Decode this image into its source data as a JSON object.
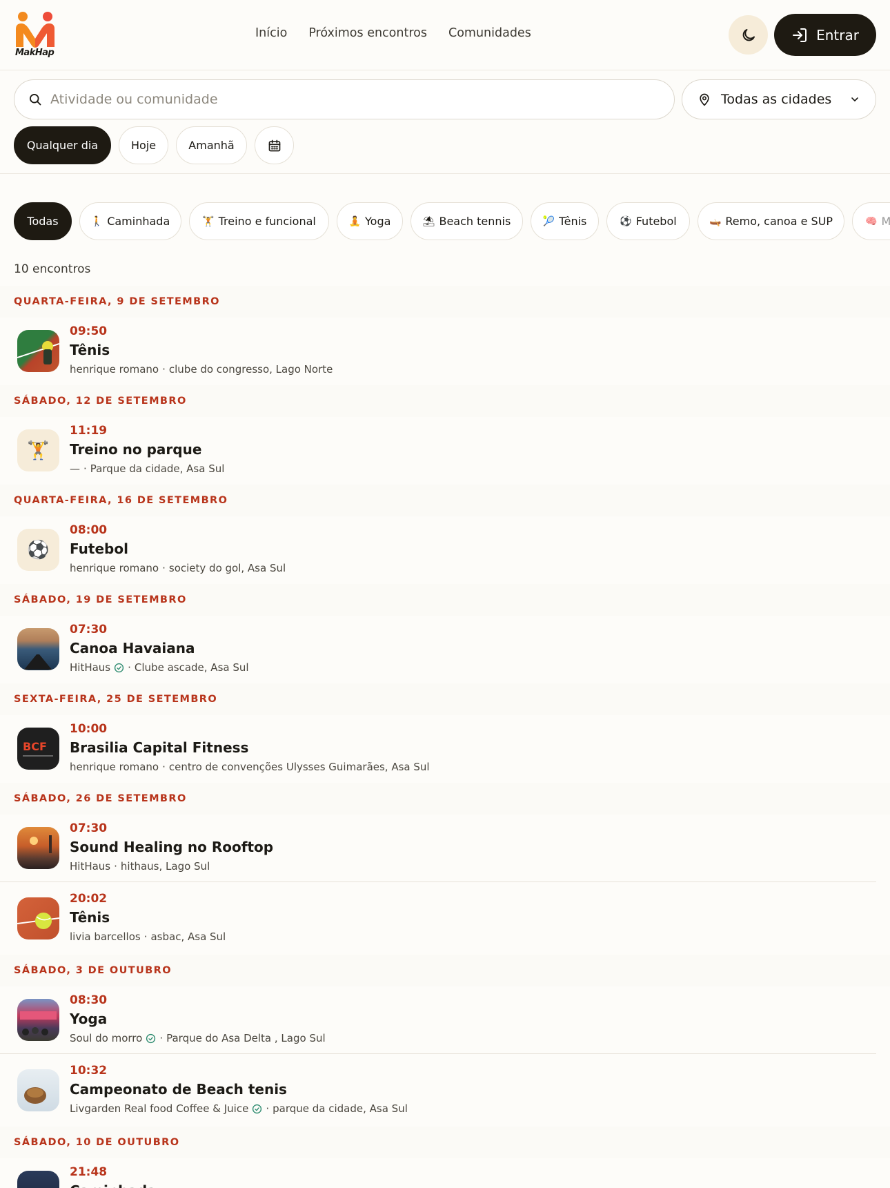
{
  "brand": {
    "name": "MakHap"
  },
  "nav": {
    "items": [
      "Início",
      "Próximos encontros",
      "Comunidades"
    ]
  },
  "header": {
    "login_label": "Entrar"
  },
  "search": {
    "placeholder": "Atividade ou comunidade",
    "value": ""
  },
  "city": {
    "selected": "Todas as cidades"
  },
  "day_filters": [
    "Qualquer dia",
    "Hoje",
    "Amanhã"
  ],
  "categories": [
    {
      "emoji": "🚶",
      "label": "Todas"
    },
    {
      "emoji": "🚶",
      "label": "Caminhada"
    },
    {
      "emoji": "🏋",
      "label": "Treino e funcional"
    },
    {
      "emoji": "🧘",
      "label": "Yoga"
    },
    {
      "emoji": "⛱",
      "label": "Beach tennis"
    },
    {
      "emoji": "🎾",
      "label": "Tênis"
    },
    {
      "emoji": "⚽",
      "label": "Futebol"
    },
    {
      "emoji": "🛶",
      "label": "Remo, canoa e SUP"
    },
    {
      "emoji": "🧠",
      "label": "M"
    }
  ],
  "results": {
    "count_label": "10 encontros"
  },
  "groups": [
    {
      "date": "QUARTA-FEIRA, 9 DE SETEMBRO",
      "events": [
        {
          "time": "09:50",
          "title": "Tênis",
          "organizer": "henrique romano",
          "verified": false,
          "location": "clube do congresso, Lago Norte",
          "thumb": "tennis-court"
        }
      ]
    },
    {
      "date": "SÁBADO, 12 DE SETEMBRO",
      "events": [
        {
          "time": "11:19",
          "title": "Treino no parque",
          "organizer": "—",
          "verified": false,
          "location": "Parque da cidade, Asa Sul",
          "thumb": "emoji",
          "emoji": "🏋"
        }
      ]
    },
    {
      "date": "QUARTA-FEIRA, 16 DE SETEMBRO",
      "events": [
        {
          "time": "08:00",
          "title": "Futebol",
          "organizer": "henrique romano",
          "verified": false,
          "location": "society do gol, Asa Sul",
          "thumb": "emoji",
          "emoji": "⚽"
        }
      ]
    },
    {
      "date": "SÁBADO, 19 DE SETEMBRO",
      "events": [
        {
          "time": "07:30",
          "title": "Canoa Havaiana",
          "organizer": "HitHaus",
          "verified": true,
          "location": "Clube ascade, Asa Sul",
          "thumb": "canoe"
        }
      ]
    },
    {
      "date": "SEXTA-FEIRA, 25 DE SETEMBRO",
      "events": [
        {
          "time": "10:00",
          "title": "Brasilia Capital Fitness",
          "organizer": "henrique romano",
          "verified": false,
          "location": "centro de convenções Ulysses Guimarães, Asa Sul",
          "thumb": "bcf"
        }
      ]
    },
    {
      "date": "SÁBADO, 26 DE SETEMBRO",
      "events": [
        {
          "time": "07:30",
          "title": "Sound Healing no Rooftop",
          "organizer": "HitHaus",
          "verified": false,
          "location": "hithaus, Lago Sul",
          "thumb": "sunset"
        },
        {
          "time": "20:02",
          "title": "Tênis",
          "organizer": "livia barcellos",
          "verified": false,
          "location": "asbac, Asa Sul",
          "thumb": "tennis-ball"
        }
      ]
    },
    {
      "date": "SÁBADO, 3 DE OUTUBRO",
      "events": [
        {
          "time": "08:30",
          "title": "Yoga",
          "organizer": "Soul do morro",
          "verified": true,
          "location": "Parque do Asa Delta , Lago Sul",
          "thumb": "group"
        },
        {
          "time": "10:32",
          "title": "Campeonato de Beach tenis",
          "organizer": "Livgarden Real food Coffee & Juice",
          "verified": true,
          "location": "parque da cidade, Asa Sul",
          "thumb": "bread"
        }
      ]
    },
    {
      "date": "SÁBADO, 10 DE OUTUBRO",
      "events": [
        {
          "time": "21:48",
          "title": "Caminhada",
          "organizer": "",
          "verified": false,
          "location": "",
          "thumb": "night"
        }
      ]
    }
  ],
  "colors": {
    "accent": "#b8341b",
    "dark": "#1e1a12",
    "bg": "#fdfcf9",
    "verified": "#2b8a6e"
  }
}
